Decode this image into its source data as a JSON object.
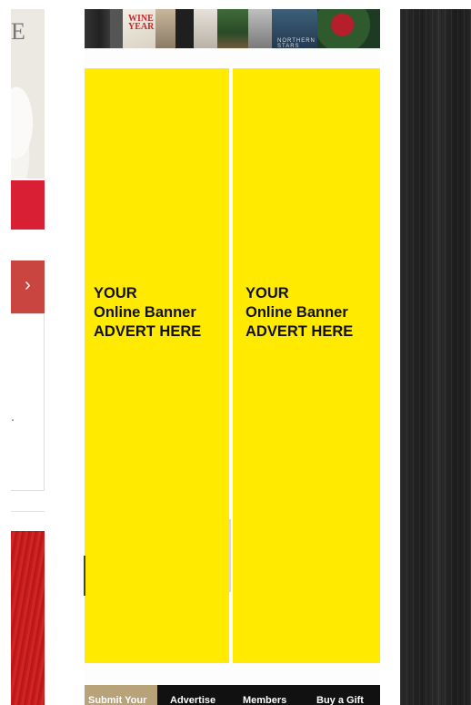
{
  "left": {
    "letter": "E",
    "arrow": "›",
    "dot": "."
  },
  "magazines": {
    "cover_1_title": "WINE YEAR",
    "cover_2_label": "NORTHERN STARS"
  },
  "banners": [
    {
      "line1": "YOUR",
      "line2": "Online Banner",
      "line3": "ADVERT HERE"
    },
    {
      "line1": "YOUR",
      "line2": "Online Banner",
      "line3": "ADVERT HERE"
    }
  ],
  "nav": {
    "items": [
      "Submit Your",
      "Advertise",
      "Members",
      "Buy a Gift"
    ]
  },
  "colors": {
    "banner_yellow": "#ffea00",
    "accent_red": "#d91f34",
    "nav_gold": "#b7a27a"
  }
}
